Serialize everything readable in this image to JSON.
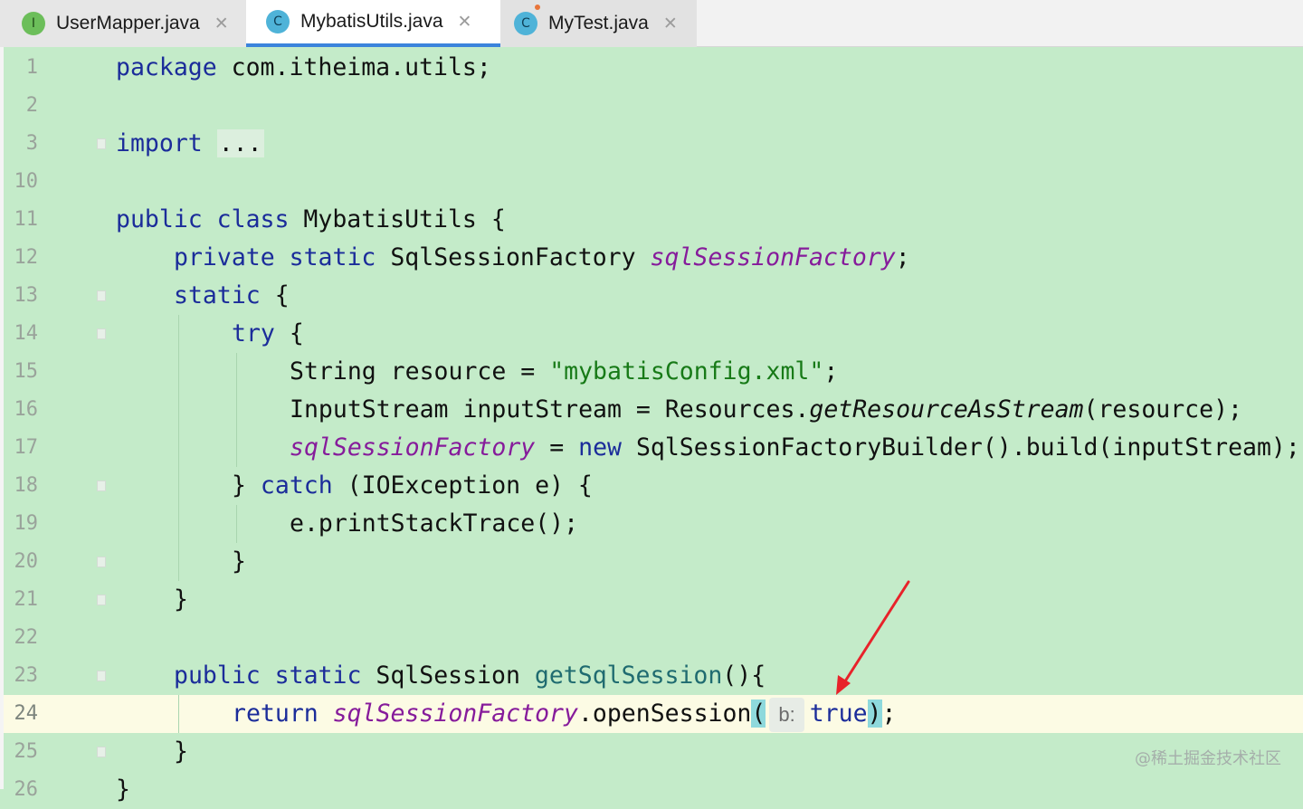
{
  "tabs": [
    {
      "label": "UserMapper.java",
      "icon": "interface-file-icon",
      "icon_letter": "I",
      "active": false
    },
    {
      "label": "MybatisUtils.java",
      "icon": "class-file-icon",
      "icon_letter": "C",
      "active": true
    },
    {
      "label": "MyTest.java",
      "icon": "test-class-file-icon",
      "icon_letter": "C",
      "active": false
    }
  ],
  "line_numbers": [
    "1",
    "2",
    "3",
    "10",
    "11",
    "12",
    "13",
    "14",
    "15",
    "16",
    "17",
    "18",
    "19",
    "20",
    "21",
    "22",
    "23",
    "24",
    "25",
    "26"
  ],
  "current_line": "24",
  "code": {
    "l1_kw": "package",
    "l1_rest": " com.itheima.utils;",
    "l3_kw": "import",
    "l3_dots": "...",
    "l11_kw": "public class",
    "l11_rest": " MybatisUtils {",
    "l12_kw": "private static",
    "l12_type": " SqlSessionFactory ",
    "l12_field": "sqlSessionFactory",
    "l12_end": ";",
    "l13_kw": "static",
    "l13_rest": " {",
    "l14_kw": "try",
    "l14_rest": " {",
    "l15_pre": "String resource = ",
    "l15_str": "\"mybatisConfig.xml\"",
    "l15_end": ";",
    "l16_pre": "InputStream inputStream = Resources.",
    "l16_static": "getResourceAsStream",
    "l16_end": "(resource);",
    "l17_field": "sqlSessionFactory",
    "l17_eq": " = ",
    "l17_kw": "new",
    "l17_rest": " SqlSessionFactoryBuilder().build(inputStream);",
    "l18_pre": "} ",
    "l18_kw": "catch",
    "l18_rest": " (IOException e) {",
    "l19": "e.printStackTrace();",
    "l20": "}",
    "l21": "}",
    "l23_kw": "public static",
    "l23_type": " SqlSession ",
    "l23_method": "getSqlSession",
    "l23_end": "(){",
    "l24_kw": "return",
    "l24_field": "sqlSessionFactory",
    "l24_call": ".openSession",
    "l24_open": "(",
    "l24_hint": "b:",
    "l24_val": "true",
    "l24_close": ")",
    "l24_end": ";",
    "l25": "}",
    "l26": "}"
  },
  "watermark": "@稀土掘金技术社区",
  "colors": {
    "editor_bg": "#c4ebc9",
    "current_line_bg": "#fcfbe4",
    "keyword": "#1b2c9a",
    "field": "#861b9b",
    "string": "#177a17",
    "active_tab_underline": "#3b84dc",
    "annotation_arrow": "#e8222a"
  }
}
